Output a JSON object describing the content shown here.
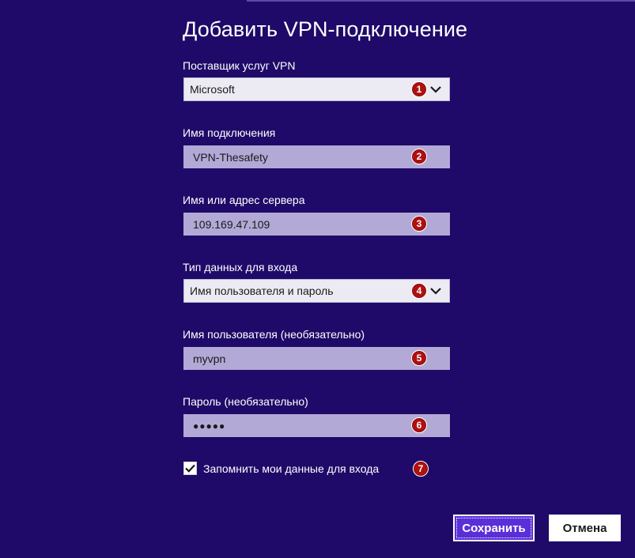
{
  "page": {
    "title": "Добавить VPN-подключение"
  },
  "form": {
    "provider": {
      "label": "Поставщик услуг VPN",
      "value": "Microsoft",
      "badge": "1"
    },
    "connection_name": {
      "label": "Имя подключения",
      "value": "VPN-Thesafety",
      "badge": "2"
    },
    "server": {
      "label": "Имя или адрес сервера",
      "value": "109.169.47.109",
      "badge": "3"
    },
    "signin_type": {
      "label": "Тип данных для входа",
      "value": "Имя пользователя и пароль",
      "badge": "4"
    },
    "username": {
      "label": "Имя пользователя (необязательно)",
      "value": "myvpn",
      "badge": "5"
    },
    "password": {
      "label": "Пароль (необязательно)",
      "value": "●●●●●",
      "badge": "6"
    },
    "remember": {
      "label": "Запомнить мои данные для входа",
      "checked": true,
      "badge": "7"
    }
  },
  "buttons": {
    "save": "Сохранить",
    "cancel": "Отмена"
  },
  "icons": {
    "dropdown": "chevron-down-icon",
    "check": "checkmark-icon"
  },
  "colors": {
    "background": "#1f0a69",
    "input_fill": "#b2a9d6",
    "select_fill": "#ecebf4",
    "badge": "#b01010",
    "primary_button": "#5a2fd8"
  }
}
